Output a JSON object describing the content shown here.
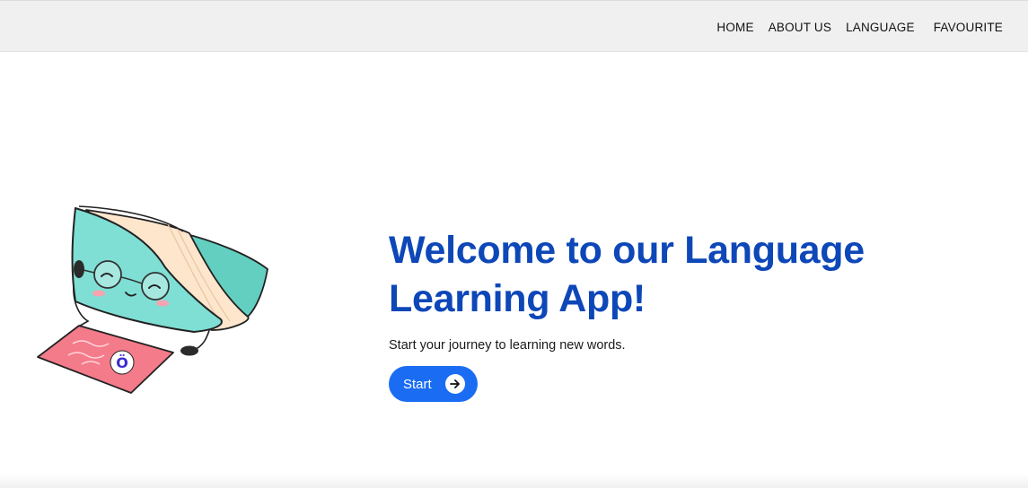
{
  "nav": {
    "items": [
      {
        "label": "HOME"
      },
      {
        "label": "ABOUT US"
      },
      {
        "label": "LANGUAGE"
      },
      {
        "label": "FAVOURITE"
      }
    ]
  },
  "hero": {
    "title": "Welcome to our Language Learning App!",
    "subtitle": "Start your journey to learning new words.",
    "start_button": {
      "label": "Start",
      "icon": "arrow-right-icon"
    },
    "illustration": "book-character-with-glasses-illustration"
  },
  "colors": {
    "navbar_bg": "#f0f0f0",
    "title": "#0d47b8",
    "button": "#1a6df2",
    "book_cover": "#7fdfd4",
    "book_pages": "#fde6cc",
    "card": "#f47b8a"
  }
}
